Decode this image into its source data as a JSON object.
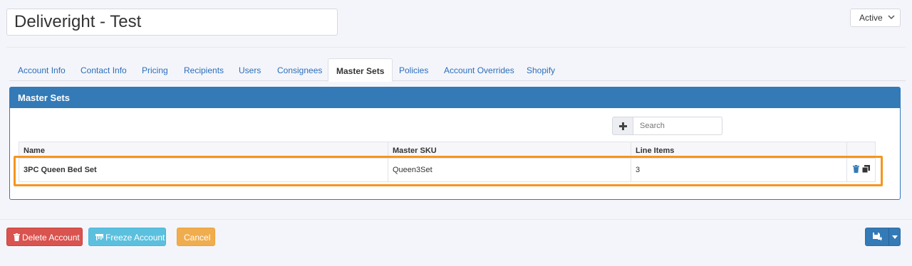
{
  "header": {
    "account_name": "Deliveright - Test",
    "status_value": "Active"
  },
  "tabs": [
    {
      "label": "Account Info"
    },
    {
      "label": "Contact Info"
    },
    {
      "label": "Pricing"
    },
    {
      "label": "Recipients"
    },
    {
      "label": "Users"
    },
    {
      "label": "Consignees"
    },
    {
      "label": "Master Sets",
      "active": true
    },
    {
      "label": "Policies"
    },
    {
      "label": "Account Overrides"
    },
    {
      "label": "Shopify"
    }
  ],
  "panel": {
    "title": "Master Sets",
    "search_placeholder": "Search",
    "add_icon": "plus-icon",
    "columns": [
      "Name",
      "Master SKU",
      "Line Items"
    ],
    "rows": [
      {
        "name": "3PC Queen Bed Set",
        "sku": "Queen3Set",
        "line_items": "3",
        "actions": [
          "trash-icon",
          "copy-icon"
        ]
      }
    ]
  },
  "footer": {
    "delete_label": "Delete Account",
    "freeze_label": "Freeze Account",
    "cancel_label": "Cancel",
    "save_icon": "save-icon"
  },
  "colors": {
    "primary": "#337ab7",
    "danger": "#d9534f",
    "info": "#5bc0de",
    "warning": "#f0ad4e",
    "highlight": "#f5961e"
  }
}
